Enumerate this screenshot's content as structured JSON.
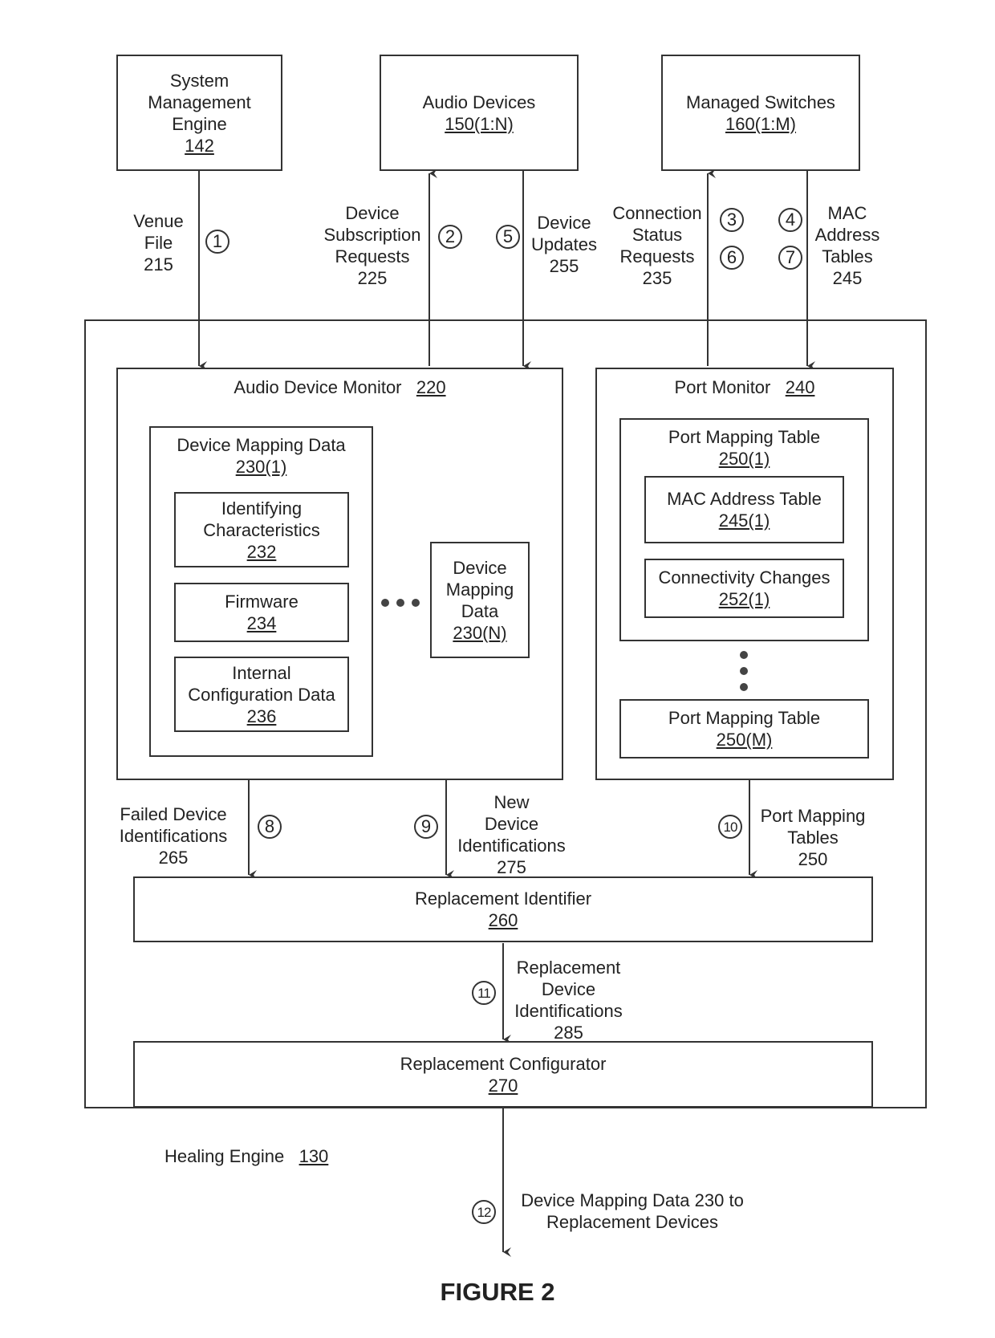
{
  "external": {
    "system_management_engine": {
      "lines": [
        "System",
        "Management",
        "Engine"
      ],
      "ref": "142"
    },
    "audio_devices": {
      "name": "Audio Devices",
      "ref": "150(1:N)"
    },
    "managed_switches": {
      "name": "Managed Switches",
      "ref": "160(1:M)"
    }
  },
  "flows": {
    "venue_file": {
      "lines": [
        "Venue",
        "File",
        "215"
      ],
      "step": "1"
    },
    "device_subscription_requests": {
      "lines": [
        "Device",
        "Subscription",
        "Requests",
        "225"
      ],
      "step": "2"
    },
    "device_updates": {
      "lines": [
        "Device",
        "Updates",
        "255"
      ],
      "step": "5"
    },
    "connection_status_requests": {
      "lines": [
        "Connection",
        "Status",
        "Requests",
        "235"
      ],
      "steps": [
        "3",
        "6"
      ]
    },
    "mac_address_tables": {
      "lines": [
        "MAC",
        "Address",
        "Tables",
        "245"
      ],
      "steps": [
        "4",
        "7"
      ]
    },
    "failed_device_identifications": {
      "lines": [
        "Failed Device",
        "Identifications",
        "265"
      ],
      "step": "8"
    },
    "new_device_identifications": {
      "lines": [
        "New",
        "Device",
        "Identifications",
        "275"
      ],
      "step": "9"
    },
    "port_mapping_tables": {
      "lines": [
        "Port Mapping",
        "Tables",
        "250"
      ],
      "step": "10"
    },
    "replacement_device_identifications": {
      "lines": [
        "Replacement",
        "Device",
        "Identifications",
        "285"
      ],
      "step": "11"
    },
    "device_mapping_output": {
      "lines": [
        "Device Mapping Data 230 to",
        "Replacement Devices"
      ],
      "step": "12"
    }
  },
  "healing_engine": {
    "name": "Healing Engine",
    "ref": "130"
  },
  "audio_device_monitor": {
    "name": "Audio Device Monitor",
    "ref": "220",
    "mapping_first": {
      "name": "Device Mapping Data",
      "ref": "230(1)",
      "items": [
        {
          "lines": [
            "Identifying",
            "Characteristics"
          ],
          "ref": "232"
        },
        {
          "lines": [
            "Firmware"
          ],
          "ref": "234"
        },
        {
          "lines": [
            "Internal",
            "Configuration Data"
          ],
          "ref": "236"
        }
      ]
    },
    "mapping_last": {
      "lines": [
        "Device",
        "Mapping",
        "Data"
      ],
      "ref": "230(N)"
    }
  },
  "port_monitor": {
    "name": "Port Monitor",
    "ref": "240",
    "table_first": {
      "name": "Port Mapping Table",
      "ref": "250(1)",
      "items": [
        {
          "name": "MAC Address Table",
          "ref": "245(1)"
        },
        {
          "name": "Connectivity Changes",
          "ref": "252(1)"
        }
      ]
    },
    "table_last": {
      "name": "Port Mapping Table",
      "ref": "250(M)"
    }
  },
  "replacement_identifier": {
    "name": "Replacement Identifier",
    "ref": "260"
  },
  "replacement_configurator": {
    "name": "Replacement Configurator",
    "ref": "270"
  },
  "figure_caption": "FIGURE 2"
}
